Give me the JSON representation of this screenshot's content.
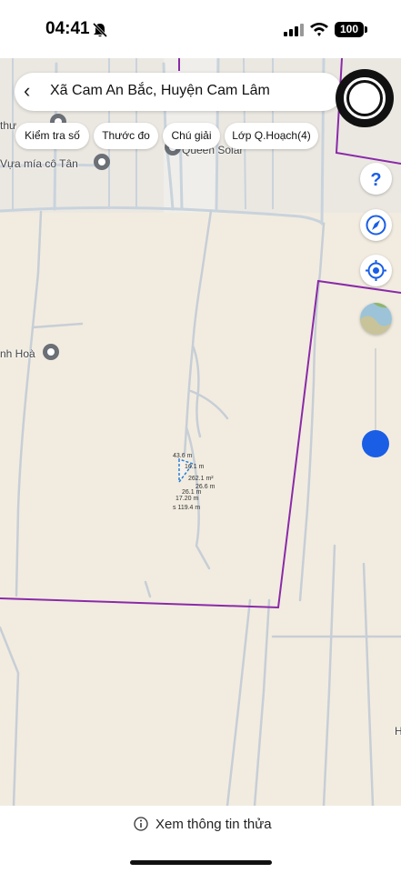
{
  "status": {
    "time": "04:41",
    "battery": "100"
  },
  "header": {
    "title": "Xã Cam An Bắc, Huyện Cam Lâm"
  },
  "chips": [
    {
      "label": "Kiểm tra số"
    },
    {
      "label": "Thước đo"
    },
    {
      "label": "Chú giải"
    },
    {
      "label": "Lớp Q.Hoạch(4)"
    }
  ],
  "map_labels": {
    "queen_solar": "Queen Solar",
    "vua_mia": "Vựa mía cô Tân",
    "nh_hoa": "nh Hoà",
    "partial_top": "thư",
    "partial_right": "H"
  },
  "measurements": {
    "m1": "43.6 m",
    "m2": "16.1 m",
    "m3": "26.1 m",
    "m4": "26.6 m",
    "m5": "17.20 m",
    "m6": "s 119.4 m",
    "area": "262.1 m²"
  },
  "controls": {
    "help": "help-icon",
    "compass": "compass-icon",
    "locate": "locate-icon",
    "layers": "satellite-layer-icon"
  },
  "bottom": {
    "info": "Xem thông tin thửa"
  },
  "colors": {
    "boundary": "#8a2aa8",
    "accent": "#1a5ee6",
    "road": "#c9d3dc",
    "land": "#f2ece0"
  }
}
